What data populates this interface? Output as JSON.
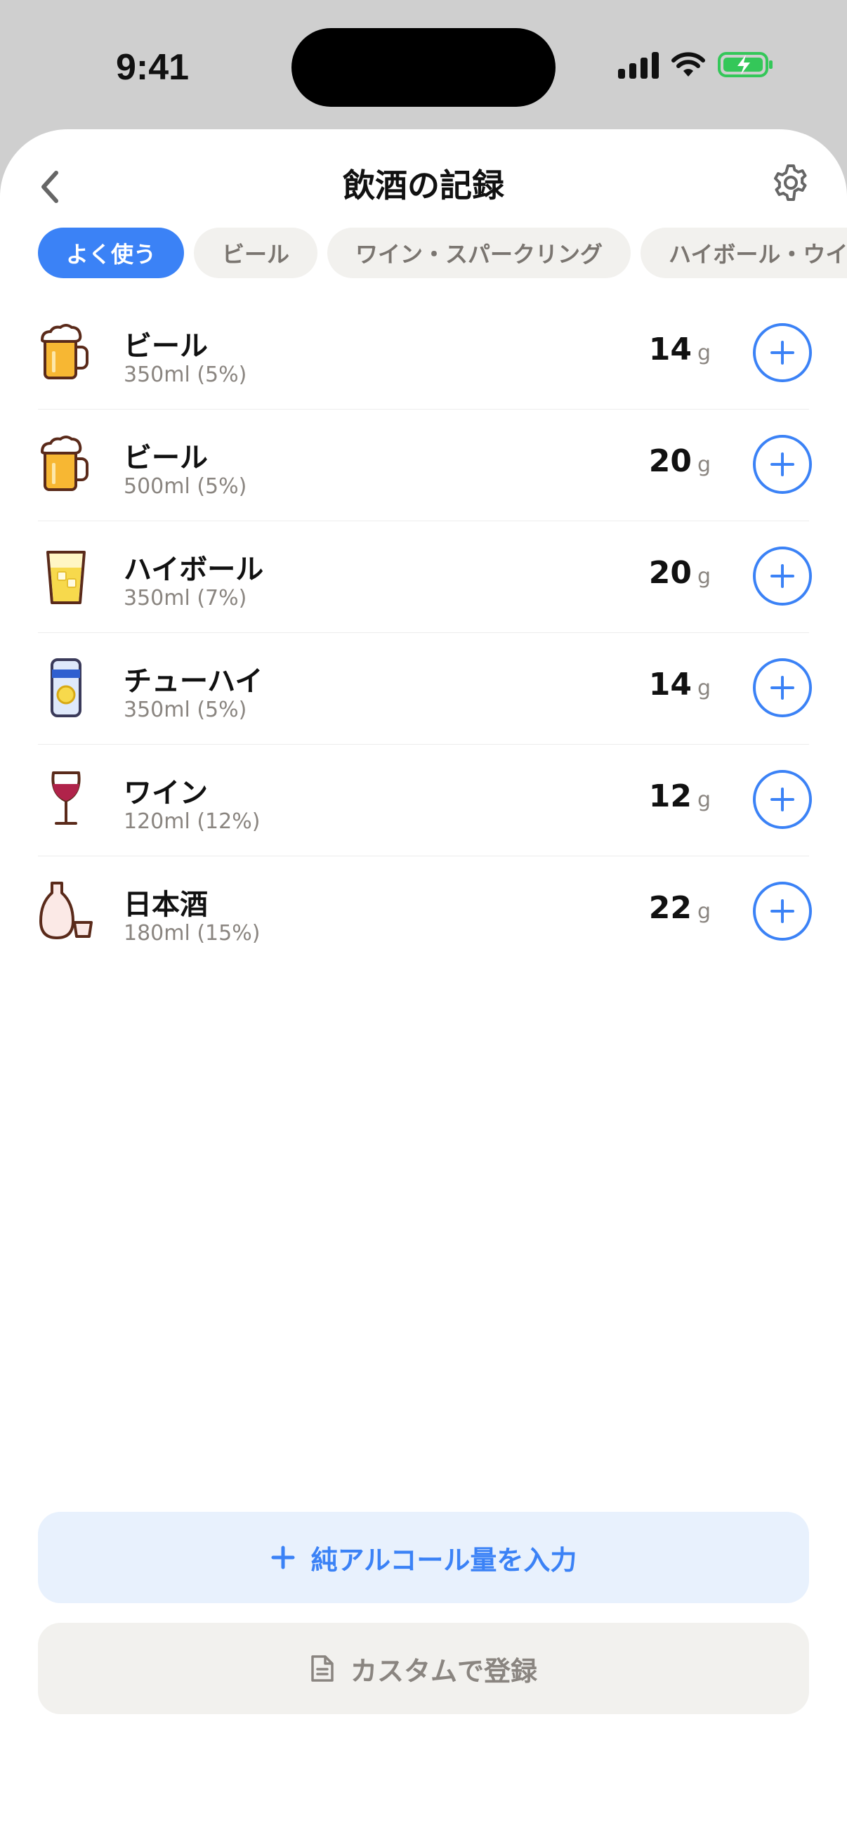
{
  "status": {
    "time": "9:41"
  },
  "header": {
    "title": "飲酒の記録"
  },
  "tabs": [
    {
      "label": "よく使う",
      "active": true
    },
    {
      "label": "ビール",
      "active": false
    },
    {
      "label": "ワイン・スパークリング",
      "active": false
    },
    {
      "label": "ハイボール・ウイ",
      "active": false
    }
  ],
  "items": [
    {
      "name": "ビール",
      "detail": "350ml (5%)",
      "amount": "14",
      "unit": "g",
      "icon": "beer-mug-icon"
    },
    {
      "name": "ビール",
      "detail": "500ml (5%)",
      "amount": "20",
      "unit": "g",
      "icon": "beer-mug-icon"
    },
    {
      "name": "ハイボール",
      "detail": "350ml (7%)",
      "amount": "20",
      "unit": "g",
      "icon": "highball-glass-icon"
    },
    {
      "name": "チューハイ",
      "detail": "350ml (5%)",
      "amount": "14",
      "unit": "g",
      "icon": "chuhai-can-icon"
    },
    {
      "name": "ワイン",
      "detail": "120ml (12%)",
      "amount": "12",
      "unit": "g",
      "icon": "wine-glass-icon"
    },
    {
      "name": "日本酒",
      "detail": "180ml (15%)",
      "amount": "22",
      "unit": "g",
      "icon": "sake-bottle-icon"
    }
  ],
  "actions": {
    "primary_label": "純アルコール量を入力",
    "secondary_label": "カスタムで登録"
  },
  "colors": {
    "accent": "#3b82f6",
    "battery": "#34c759"
  }
}
